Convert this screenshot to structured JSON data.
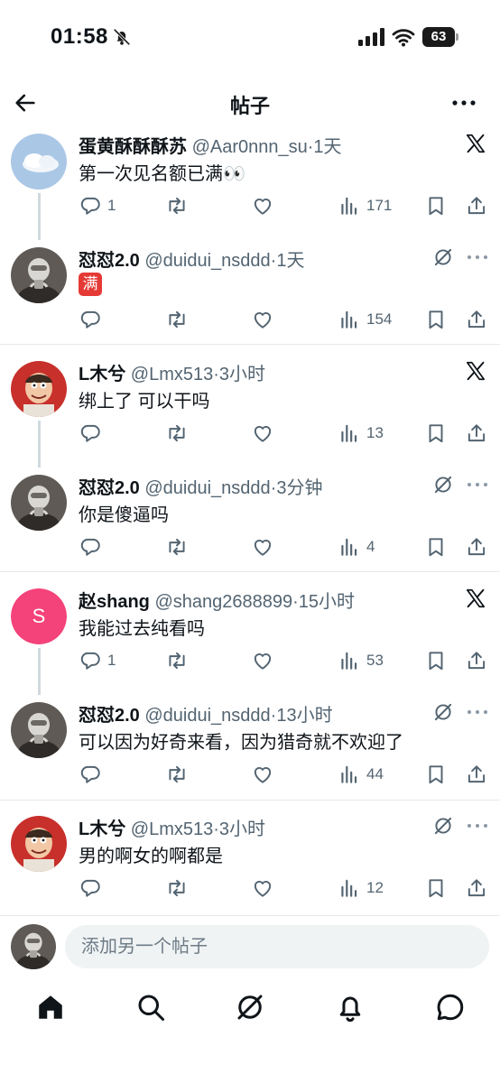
{
  "status_bar": {
    "time": "01:58",
    "battery": "63"
  },
  "header": {
    "title": "帖子"
  },
  "tweets": [
    {
      "name": "蛋黄酥酥酥苏",
      "handle": "@Aar0nnn_su",
      "time": "·1天",
      "text": "第一次见名额已满👀",
      "replies": "1",
      "views": "171"
    },
    {
      "name": "怼怼2.0",
      "handle": "@duidui_nsddd",
      "time": "·1天",
      "badge": "满",
      "views": "154"
    },
    {
      "name": "L木兮",
      "handle": "@Lmx513",
      "time": "·3小时",
      "text": "绑上了 可以干吗",
      "views": "13"
    },
    {
      "name": "怼怼2.0",
      "handle": "@duidui_nsddd",
      "time": "·3分钟",
      "text": "你是傻逼吗",
      "views": "4"
    },
    {
      "name": "赵shang",
      "handle": "@shang2688899",
      "time": "·15小时",
      "avatar_letter": "S",
      "text": "我能过去纯看吗",
      "replies": "1",
      "views": "53"
    },
    {
      "name": "怼怼2.0",
      "handle": "@duidui_nsddd",
      "time": "·13小时",
      "text": "可以因为好奇来看，因为猎奇就不欢迎了",
      "views": "44"
    },
    {
      "name": "L木兮",
      "handle": "@Lmx513",
      "time": "·3小时",
      "text": "男的啊女的啊都是",
      "views": "12"
    }
  ],
  "composer": {
    "placeholder": "添加另一个帖子"
  },
  "icons": {
    "back": "back-arrow-icon",
    "more": "more-horizontal-icon",
    "x_logo": "x-logo-icon",
    "grok": "grok-icon",
    "reply": "reply-icon",
    "repost": "repost-icon",
    "like": "heart-icon",
    "views": "views-icon",
    "bookmark": "bookmark-icon",
    "share": "share-icon",
    "home": "home-icon",
    "search": "search-icon",
    "notifications": "bell-icon",
    "messages": "messages-icon"
  },
  "colors": {
    "text": "#0f1419",
    "muted": "#536471",
    "thread_line": "#cfd9de",
    "avatar_pink": "#f4427a",
    "badge_red": "#e53935"
  }
}
